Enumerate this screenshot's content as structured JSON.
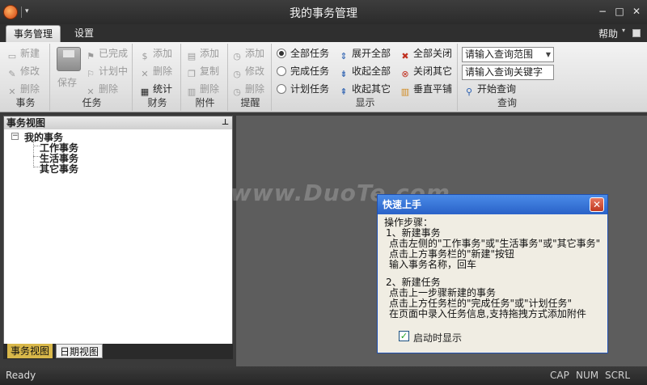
{
  "window": {
    "title": "我的事务管理",
    "controls": [
      "−",
      "□",
      "✕"
    ],
    "qat_dropdown": "▾"
  },
  "tabs": [
    "事务管理",
    "设置"
  ],
  "help": {
    "label": "帮助",
    "caret": "▾"
  },
  "ribbon": {
    "groups": {
      "affair": {
        "label": "事务",
        "buttons": [
          "新建",
          "修改",
          "删除"
        ]
      },
      "task": {
        "label": "任务",
        "save": "保存",
        "buttons": [
          "已完成",
          "计划中",
          "删除"
        ]
      },
      "finance": {
        "label": "财务",
        "buttons": [
          "添加",
          "删除",
          "统计"
        ]
      },
      "attach": {
        "label": "附件",
        "buttons": [
          "添加",
          "复制",
          "删除"
        ]
      },
      "remind": {
        "label": "提醒",
        "buttons": [
          "添加",
          "修改",
          "删除"
        ]
      },
      "display": {
        "label": "显示",
        "radios": [
          "全部任务",
          "完成任务",
          "计划任务"
        ],
        "expand": [
          "展开全部",
          "收起全部",
          "收起其它"
        ],
        "close": [
          "全部关闭",
          "关闭其它",
          "垂直平铺"
        ]
      },
      "query": {
        "label": "查询",
        "range_placeholder": "请输入查询范围",
        "keyword_placeholder": "请输入查询关键字",
        "search": "开始查询"
      }
    }
  },
  "left_panel": {
    "title": "事务视图",
    "pin": "⊥",
    "tree": {
      "root": "我的事务",
      "children": [
        "工作事务",
        "生活事务",
        "其它事务"
      ]
    },
    "tabs": [
      "事务视图",
      "日期视图"
    ]
  },
  "watermark": "www.DuoTe.com",
  "dialog": {
    "title": "快速上手",
    "lines": [
      "操作步骤：",
      "1、新建事务",
      "点击左侧的\"工作事务\"或\"生活事务\"或\"其它事务\"",
      "点击上方事务栏的\"新建\"按钮",
      "输入事务名称，回车",
      "",
      "2、新建任务",
      "点击上一步骤新建的事务",
      "点击上方任务栏的\"完成任务\"或\"计划任务\"",
      "在页面中录入任务信息,支持拖拽方式添加附件"
    ],
    "checkbox_label": "启动时显示",
    "checkbox_checked": true
  },
  "statusbar": {
    "ready": "Ready",
    "keys": [
      "CAP",
      "NUM",
      "SCRL"
    ]
  }
}
